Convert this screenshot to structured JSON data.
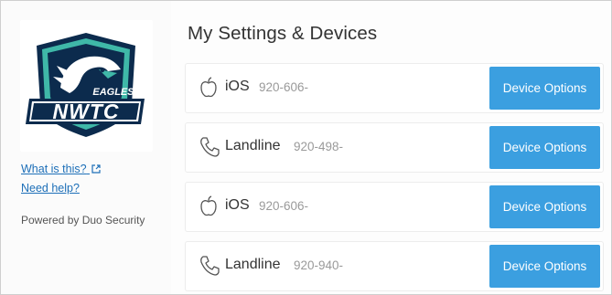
{
  "logo": {
    "word_top": "EAGLES",
    "word_main": "NWTC"
  },
  "sidebar": {
    "what_is_this": "What is this?",
    "need_help": "Need help?",
    "powered_by": "Powered by Duo Security"
  },
  "main": {
    "title": "My Settings & Devices"
  },
  "devices": [
    {
      "icon": "apple-icon",
      "type": "iOS",
      "number": "920-606-",
      "button": "Device Options"
    },
    {
      "icon": "phone-icon",
      "type": "Landline",
      "number": "920-498-",
      "button": "Device Options"
    },
    {
      "icon": "apple-icon",
      "type": "iOS",
      "number": "920-606-",
      "button": "Device Options"
    },
    {
      "icon": "phone-icon",
      "type": "Landline",
      "number": "920-940-",
      "button": "Device Options"
    }
  ],
  "colors": {
    "button": "#3b9fe0",
    "link": "#1d6fb8",
    "logo_navy": "#0c2b4d",
    "logo_teal": "#3fb8a8"
  }
}
